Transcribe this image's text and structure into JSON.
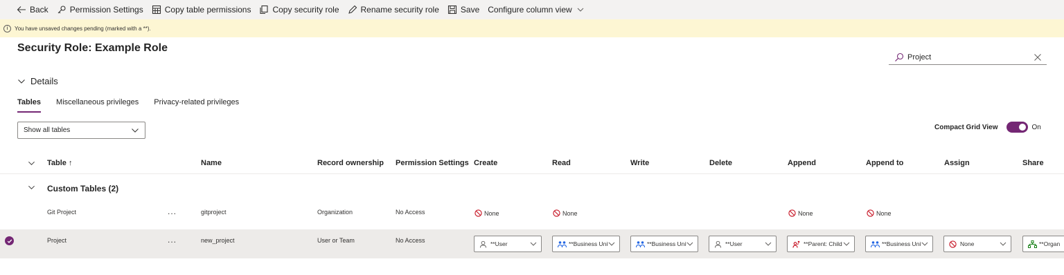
{
  "colors": {
    "accent": "#742774",
    "warning_bg": "#fdf6d3",
    "none_red": "#c50f1f",
    "bu_blue": "#2266e3",
    "org_green": "#107c10"
  },
  "toolbar": [
    {
      "label": "Back",
      "icon": "back-arrow-icon"
    },
    {
      "label": "Permission Settings",
      "icon": "key-icon"
    },
    {
      "label": "Copy table permissions",
      "icon": "table-icon"
    },
    {
      "label": "Copy security role",
      "icon": "copy-icon"
    },
    {
      "label": "Rename security role",
      "icon": "pencil-icon"
    },
    {
      "label": "Save",
      "icon": "save-icon"
    },
    {
      "label": "Configure column view",
      "icon": "chevron-down-icon"
    }
  ],
  "warning": {
    "text": "You have unsaved changes pending (marked with a **)."
  },
  "page": {
    "title": "Security Role: Example Role"
  },
  "search": {
    "value": "Project"
  },
  "details": {
    "label": "Details"
  },
  "tabs": [
    "Tables",
    "Miscellaneous privileges",
    "Privacy-related privileges"
  ],
  "filter": {
    "value": "Show all tables"
  },
  "compact": {
    "label": "Compact Grid View",
    "state": "On"
  },
  "grid": {
    "headers": [
      "Table ↑",
      "Name",
      "Record ownership",
      "Permission Settings",
      "Create",
      "Read",
      "Write",
      "Delete",
      "Append",
      "Append to",
      "Assign",
      "Share"
    ],
    "group": "Custom Tables (2)",
    "rows": [
      {
        "table": "Git Project",
        "more": "...",
        "name": "gitproject",
        "ownership": "Organization",
        "permission": "No Access",
        "create": "None",
        "read": "None",
        "append": "None",
        "append_to": "None"
      },
      {
        "table": "Project",
        "more": "...",
        "name": "new_project",
        "ownership": "User or Team",
        "permission": "No Access",
        "create": "**User",
        "read": "**Business Unit",
        "write": "**Business Unit",
        "delete": "**User",
        "append": "**Parent: Child Business Unit",
        "append_to": "**Business Unit",
        "assign": "None",
        "share": "**Organization"
      }
    ]
  }
}
